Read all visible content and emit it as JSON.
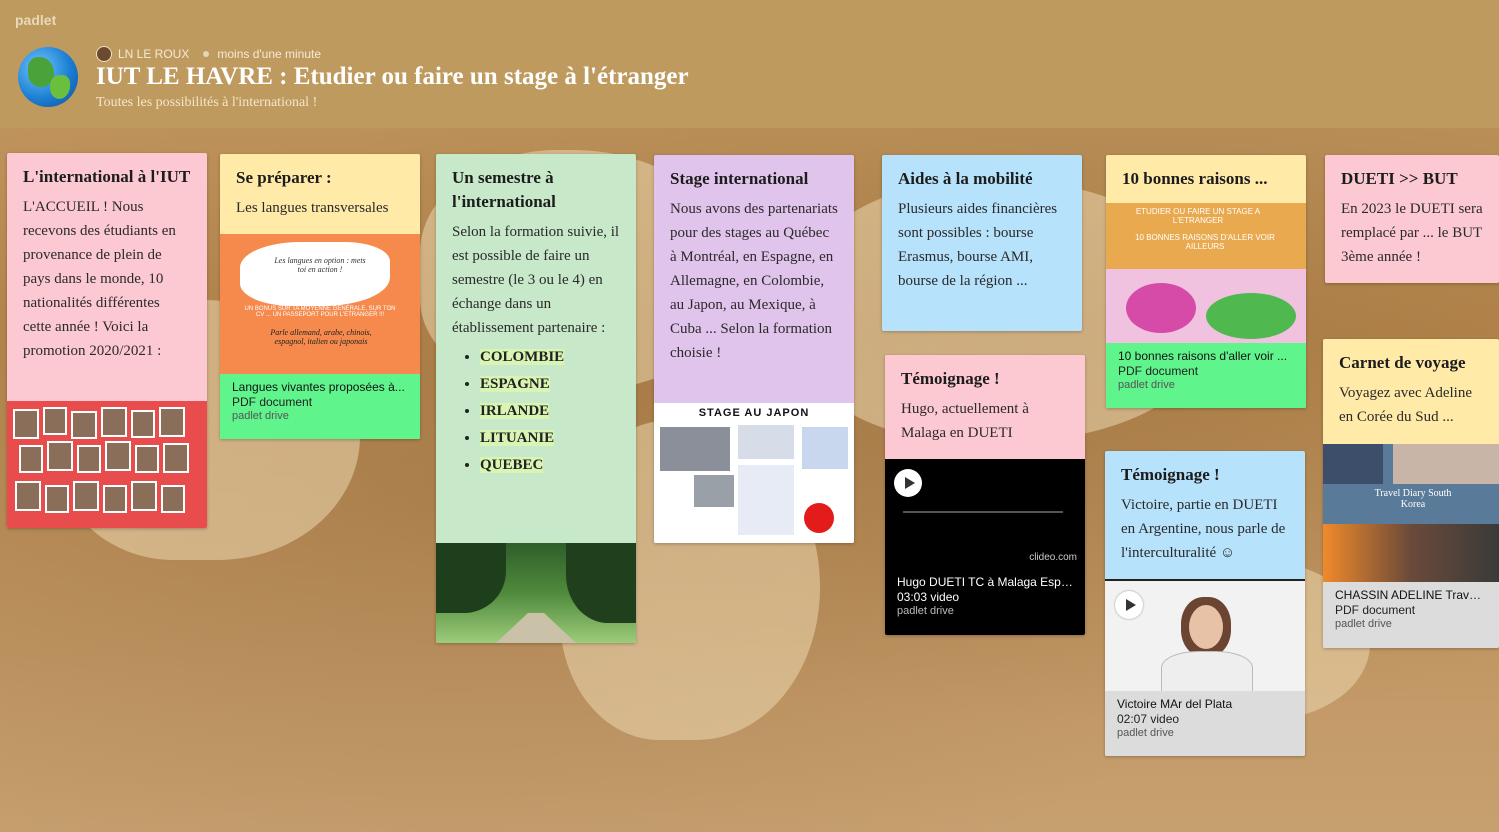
{
  "app": {
    "brand": "padlet"
  },
  "header": {
    "author": "LN LE ROUX",
    "time": "moins d'une minute",
    "title": "IUT LE HAVRE : Etudier ou faire un stage à l'étranger",
    "subtitle": "Toutes les possibilités à l'international !",
    "icon": "globe-icon"
  },
  "cards": {
    "international": {
      "title": "L'international à l'IUT",
      "body": "L'ACCUEIL ! Nous recevons des étudiants en provenance de plein de pays dans le monde, 10 nationalités différentes cette année ! Voici la promotion 2020/2021 :"
    },
    "preparer": {
      "title": "Se préparer :",
      "body": "Les langues transversales",
      "image_caption": "Les langues en option : mets toi en action !",
      "image_text": "UN BONUS SUR TA MOYENNE GÉNÉRALE, SUR TON CV ... UN PASSEPORT POUR L'ETRANGER !!!",
      "image_langs": "Parle allemand, arabe, chinois, espagnol, italien ou japonais",
      "attachment": {
        "title": "Langues vivantes proposées à...",
        "kind": "PDF document",
        "source": "padlet drive"
      }
    },
    "semestre": {
      "title": "Un semestre à l'international",
      "body": "Selon la formation suivie, il est possible de faire un semestre (le 3 ou le 4) en échange dans un établissement partenaire :",
      "list": [
        "COLOMBIE",
        "ESPAGNE",
        "IRLANDE",
        "LITUANIE",
        "QUEBEC"
      ]
    },
    "stage": {
      "title": "Stage international",
      "body": "Nous avons des partenariats pour des stages au Québec à Montréal, en Espagne, en Allemagne, en Colombie, au Japon, au Mexique, à Cuba ... Selon la formation choisie !",
      "image_title": "STAGE AU JAPON"
    },
    "aides": {
      "title": "Aides à la mobilité",
      "body": "Plusieurs aides financières sont possibles : bourse Erasmus, bourse AMI, bourse de la région ..."
    },
    "temoignage1": {
      "title": "Témoignage !",
      "body": "Hugo, actuellement à Malaga en DUETI",
      "watermark": "clideo.com",
      "attachment": {
        "title": "Hugo DUETI TC à Malaga Espa...",
        "kind": "03:03 video",
        "source": "padlet drive"
      }
    },
    "raisons": {
      "title": "10 bonnes raisons ...",
      "image_line1": "ETUDIER OU FAIRE UN STAGE A L'ETRANGER",
      "image_line2": "10 BONNES RAISONS D'ALLER VOIR AILLEURS",
      "attachment": {
        "title": "10 bonnes raisons d'aller voir ...",
        "kind": "PDF document",
        "source": "padlet drive"
      }
    },
    "temoignage2": {
      "title": "Témoignage !",
      "body": "Victoire, partie en DUETI en Argentine, nous parle de l'interculturalité ☺",
      "attachment": {
        "title": "Victoire MAr del Plata",
        "kind": "02:07 video",
        "source": "padlet drive"
      }
    },
    "dueti": {
      "title": "DUETI >> BUT",
      "body": "En 2023 le DUETI sera remplacé par ... le BUT 3ème année !"
    },
    "carnet": {
      "title": "Carnet de voyage",
      "body": "Voyagez avec Adeline en Corée du Sud ...",
      "image_text": "Travel Diary South Korea",
      "attachment": {
        "title": "CHASSIN ADELINE Travel Diary",
        "kind": "PDF document",
        "source": "padlet drive"
      }
    }
  },
  "colors": {
    "header": "#bf9a5f",
    "pink": "#fcc9d3",
    "yellow": "#ffeaa8",
    "green": "#c7e8c9",
    "purple": "#e1c4ec",
    "blue": "#b6e2fb",
    "attachment_green": "#5ff58c"
  }
}
